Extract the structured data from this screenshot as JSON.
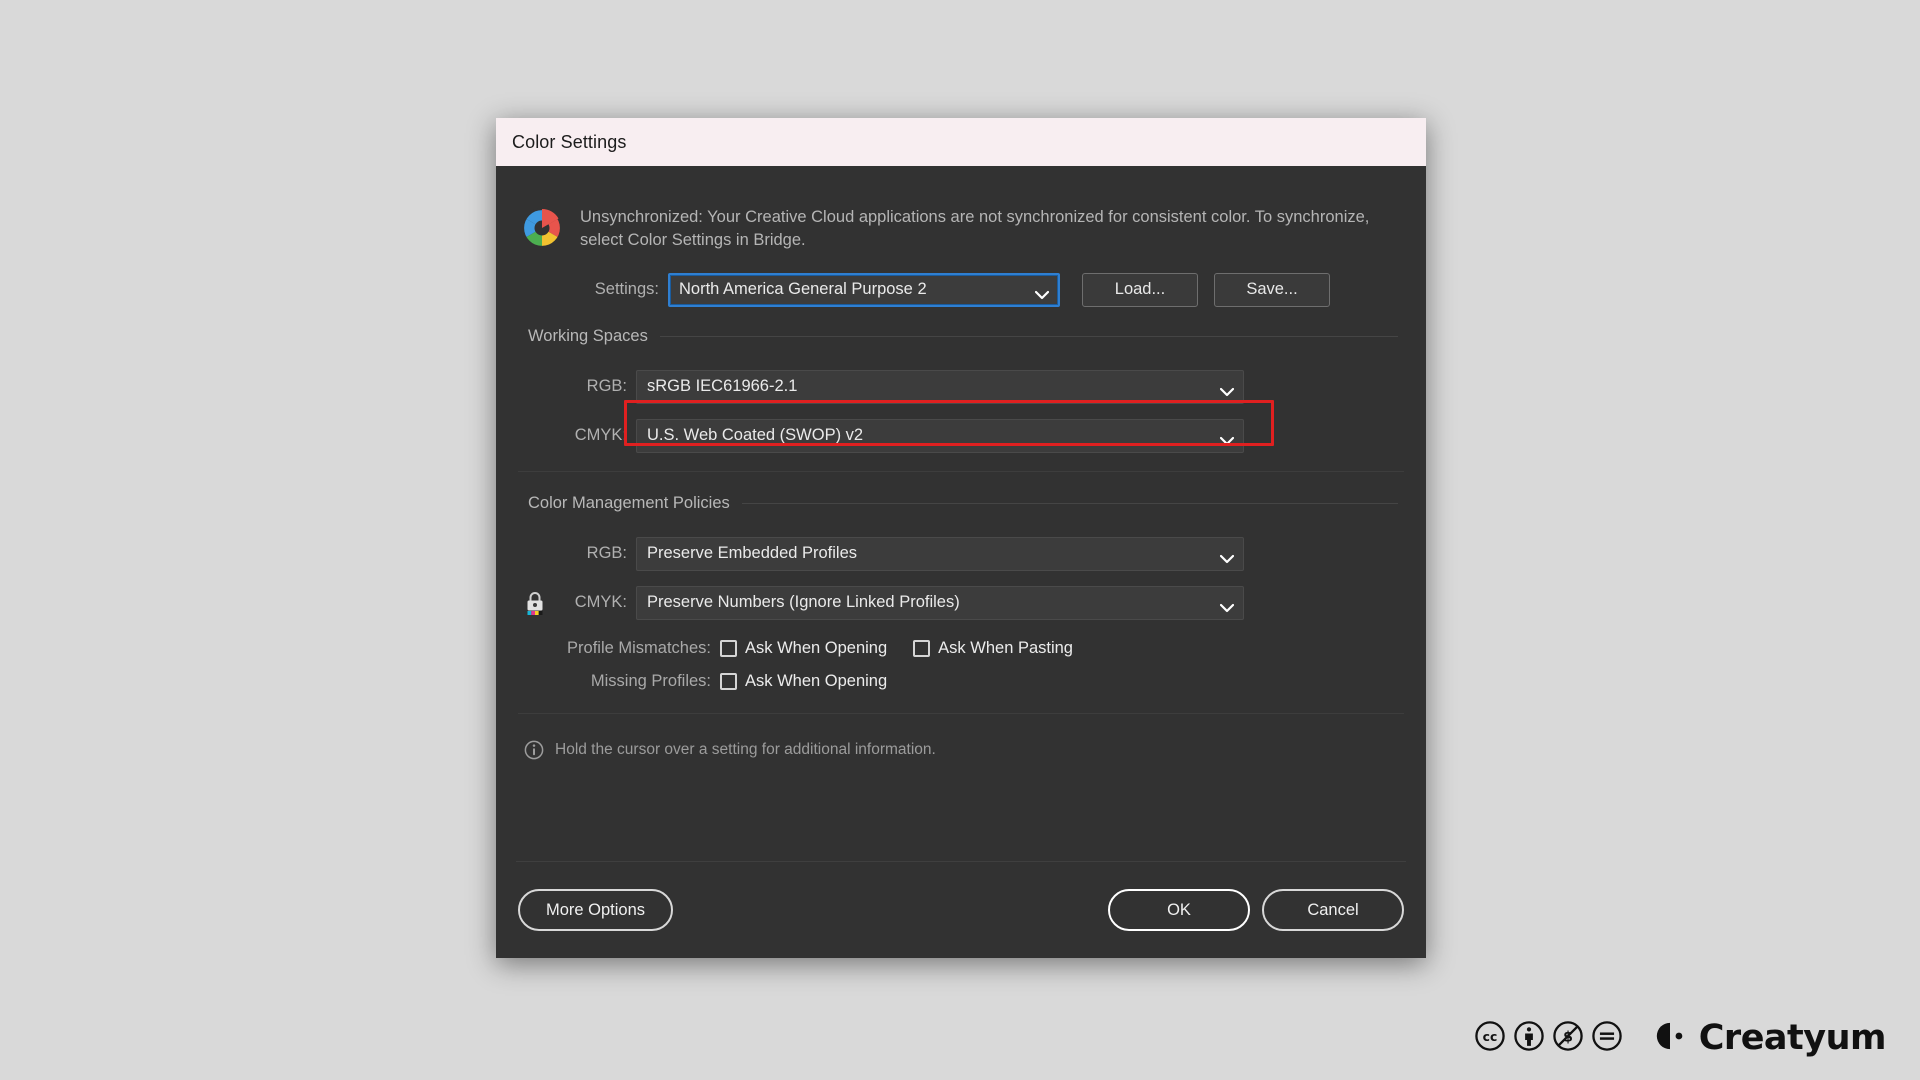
{
  "window": {
    "title": "Color Settings"
  },
  "notice": {
    "icon": "creative-cloud-color-wheel-icon",
    "text": "Unsynchronized: Your Creative Cloud applications are not synchronized for consistent color. To synchronize, select Color Settings in Bridge."
  },
  "settings_row": {
    "label": "Settings:",
    "value": "North America General Purpose 2",
    "load_label": "Load...",
    "save_label": "Save..."
  },
  "working_spaces": {
    "title": "Working Spaces",
    "rgb": {
      "label": "RGB:",
      "value": "sRGB IEC61966-2.1"
    },
    "cmyk": {
      "label": "CMYK:",
      "value": "U.S. Web Coated (SWOP) v2"
    }
  },
  "policies": {
    "title": "Color Management Policies",
    "rgb": {
      "label": "RGB:",
      "value": "Preserve Embedded Profiles"
    },
    "cmyk": {
      "label": "CMYK:",
      "value": "Preserve Numbers (Ignore Linked Profiles)",
      "icon": "cmyk-lock-icon"
    },
    "profile_mismatches": {
      "label": "Profile Mismatches:",
      "ask_when_opening": "Ask When Opening",
      "ask_when_opening_checked": false,
      "ask_when_pasting": "Ask When Pasting",
      "ask_when_pasting_checked": false
    },
    "missing_profiles": {
      "label": "Missing Profiles:",
      "ask_when_opening": "Ask When Opening",
      "ask_when_opening_checked": false
    }
  },
  "hint": {
    "icon": "info-circle-icon",
    "text": "Hold the cursor over a setting for additional information."
  },
  "footer": {
    "more_options_label": "More Options",
    "ok_label": "OK",
    "cancel_label": "Cancel"
  },
  "annotation": {
    "color": "#e02020",
    "target": "working-spaces-cmyk-row"
  },
  "watermark": {
    "badges": [
      "cc-icon",
      "cc-by-icon",
      "cc-nc-icon",
      "cc-nd-icon"
    ],
    "brand": "Creatyum"
  },
  "colors": {
    "dialog_bg": "#323232",
    "titlebar_bg": "#f8eef1",
    "field_bg": "#3c3c3c",
    "focus_blue": "#2f7fd1",
    "annotation_red": "#e02020",
    "page_bg": "#d9d9d9"
  }
}
